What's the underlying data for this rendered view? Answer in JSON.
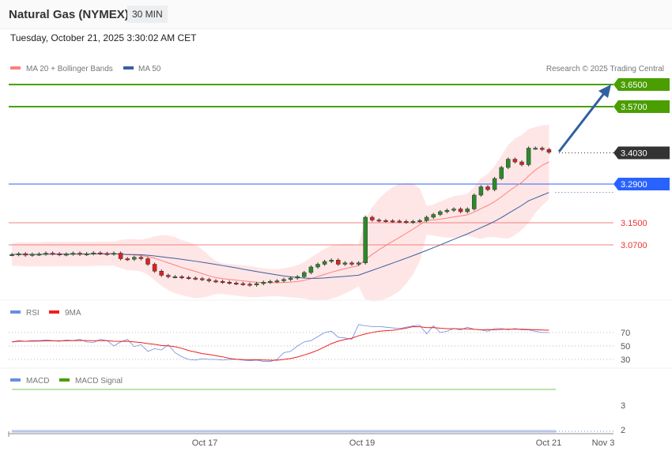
{
  "header": {
    "title": "Natural Gas (NYMEX)",
    "timeframe": "30 MIN",
    "datetime": "Tuesday, October 21, 2025 3:30:02 AM CET"
  },
  "legend": {
    "ma20": "MA 20 + Bollinger Bands",
    "ma50": "MA 50",
    "credit": "Research © 2025 Trading Central",
    "rsi": "RSI",
    "rsi_ma": "9MA",
    "macd": "MACD",
    "macd_signal": "MACD Signal"
  },
  "colors": {
    "resistance": "#4a9e00",
    "current": "#333333",
    "pivot": "#2962ff",
    "support": "#f08080",
    "arrow": "#3060a0",
    "ma20": "#ff7f7f",
    "ma50": "#3a5fa0",
    "rsi": "#6a8ee0",
    "rsi_ma": "#ee2020"
  },
  "levels": [
    {
      "value": 3.65,
      "label": "3.6500",
      "type": "resistance"
    },
    {
      "value": 3.57,
      "label": "3.5700",
      "type": "resistance"
    },
    {
      "value": 3.403,
      "label": "3.4030",
      "type": "current"
    },
    {
      "value": 3.29,
      "label": "3.2900",
      "type": "pivot"
    },
    {
      "value": 3.15,
      "label": "3.1500",
      "type": "support"
    },
    {
      "value": 3.07,
      "label": "3.0700",
      "type": "support"
    }
  ],
  "chart_data": {
    "type": "candlestick",
    "closes": [
      3.035,
      3.038,
      3.033,
      3.036,
      3.037,
      3.04,
      3.038,
      3.035,
      3.037,
      3.04,
      3.036,
      3.038,
      3.041,
      3.039,
      3.037,
      3.04,
      3.02,
      3.018,
      3.025,
      3.02,
      3.0,
      2.975,
      2.96,
      2.955,
      2.955,
      2.952,
      2.95,
      2.948,
      2.945,
      2.94,
      2.938,
      2.935,
      2.932,
      2.93,
      2.928,
      2.925,
      2.93,
      2.935,
      2.938,
      2.94,
      2.945,
      2.95,
      2.955,
      2.97,
      2.99,
      3.0,
      3.01,
      3.015,
      3.0,
      3.005,
      3.0,
      3.005,
      3.17,
      3.16,
      3.158,
      3.157,
      3.156,
      3.155,
      3.152,
      3.155,
      3.158,
      3.17,
      3.18,
      3.19,
      3.195,
      3.2,
      3.19,
      3.2,
      3.25,
      3.28,
      3.27,
      3.31,
      3.35,
      3.38,
      3.37,
      3.36,
      3.42,
      3.42,
      3.415,
      3.405
    ],
    "rsi": [
      56,
      58,
      57,
      58,
      58,
      59,
      58,
      57,
      59,
      58,
      60,
      56,
      55,
      60,
      58,
      50,
      56,
      60,
      49,
      52,
      42,
      46,
      44,
      52,
      40,
      34,
      30,
      29,
      31,
      30,
      30,
      29,
      30,
      30,
      29,
      28,
      29,
      27,
      27,
      30,
      40,
      42,
      50,
      56,
      58,
      64,
      70,
      72,
      63,
      62,
      60,
      82,
      80,
      79,
      79,
      78,
      77,
      76,
      78,
      80,
      81,
      68,
      80,
      70,
      72,
      76,
      74,
      78,
      75,
      74,
      72,
      76,
      76,
      74,
      76,
      74,
      74,
      72,
      70,
      70
    ],
    "x_ticks": [
      "Oct 17",
      "Oct 19",
      "Oct 21",
      "Nov 3"
    ],
    "rsi_ticks": [
      70,
      50,
      30
    ],
    "macd_ticks": [
      3,
      2
    ]
  }
}
